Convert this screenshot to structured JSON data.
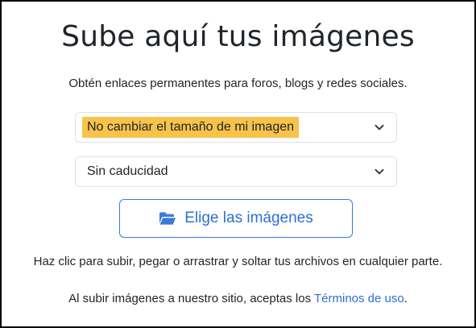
{
  "page": {
    "title": "Sube aquí tus imágenes",
    "subtitle": "Obtén enlaces permanentes para foros, blogs y redes sociales."
  },
  "resize_select": {
    "value": "No cambiar el tamaño de mi imagen",
    "icon": "chevron-down-icon"
  },
  "expiry_select": {
    "value": "Sin caducidad",
    "icon": "chevron-down-icon"
  },
  "upload_button": {
    "label": "Elige las imágenes",
    "icon": "folder-open-icon"
  },
  "hint": "Haz clic para subir, pegar o arrastrar y soltar tus archivos en cualquier parte.",
  "terms": {
    "prefix": "Al subir imágenes a nuestro sitio, aceptas los ",
    "link": "Términos de uso",
    "suffix": "."
  },
  "colors": {
    "accent": "#2f6fd0",
    "highlight": "#f7c34b",
    "text": "#212529",
    "border": "#dee2e6"
  }
}
